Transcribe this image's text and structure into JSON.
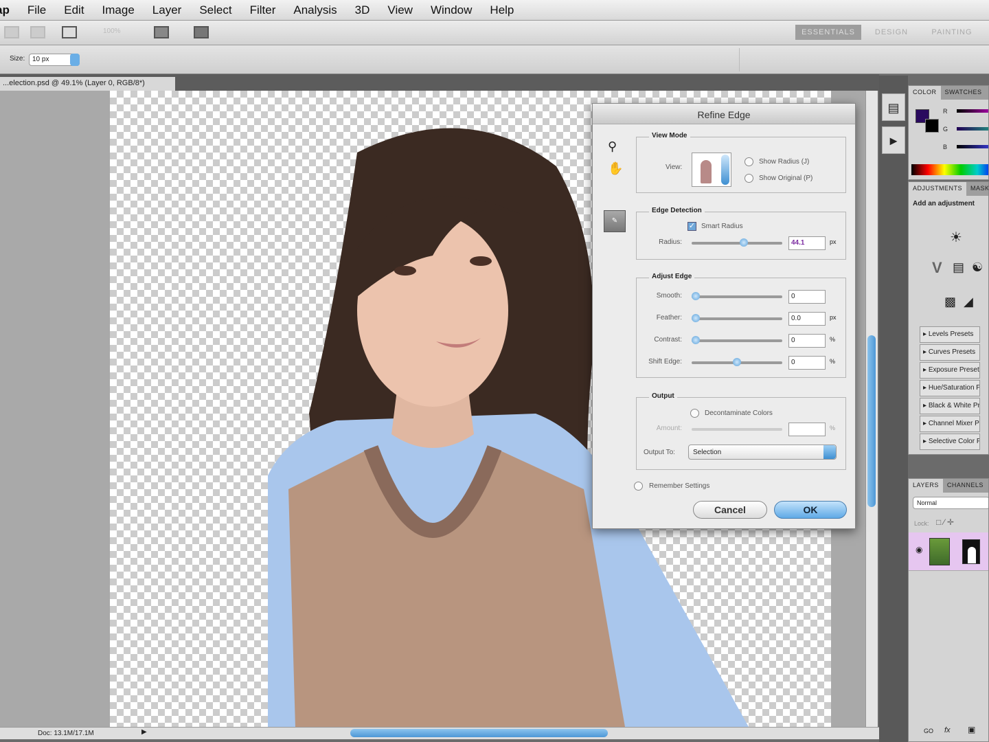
{
  "menu": {
    "items": [
      "ap",
      "File",
      "Edit",
      "Image",
      "Layer",
      "Select",
      "Filter",
      "Analysis",
      "3D",
      "View",
      "Window",
      "Help"
    ]
  },
  "appbar": {
    "zoom": "100%",
    "workspaces": [
      "ESSENTIALS",
      "DESIGN",
      "PAINTING"
    ]
  },
  "options": {
    "size_label": "Size:",
    "size_value": "10 px"
  },
  "document": {
    "tab_title": "...election.psd @ 49.1% (Layer 0, RGB/8*)",
    "status": "Doc: 13.1M/17.1M"
  },
  "dialog": {
    "title": "Refine Edge",
    "view_mode": {
      "label": "View Mode",
      "view_label": "View:",
      "show_radius": "Show Radius (J)",
      "show_original": "Show Original (P)"
    },
    "edge_detection": {
      "label": "Edge Detection",
      "smart_radius": "Smart Radius",
      "radius_label": "Radius:",
      "radius_value": "44.1",
      "radius_unit": "px",
      "radius_fraction": 0.58
    },
    "adjust_edge": {
      "label": "Adjust Edge",
      "rows": [
        {
          "label": "Smooth:",
          "value": "0",
          "unit": "",
          "fraction": 0
        },
        {
          "label": "Feather:",
          "value": "0.0",
          "unit": "px",
          "fraction": 0
        },
        {
          "label": "Contrast:",
          "value": "0",
          "unit": "%",
          "fraction": 0
        },
        {
          "label": "Shift Edge:",
          "value": "0",
          "unit": "%",
          "fraction": 0.5
        }
      ]
    },
    "output": {
      "label": "Output",
      "decontaminate": "Decontaminate Colors",
      "amount_label": "Amount:",
      "amount_unit": "%",
      "output_to_label": "Output To:",
      "output_to_value": "Selection"
    },
    "remember": "Remember Settings",
    "cancel": "Cancel",
    "ok": "OK"
  },
  "panels": {
    "color": {
      "tabs": [
        "COLOR",
        "SWATCHES"
      ],
      "channels": [
        "R",
        "G",
        "B"
      ],
      "foreground": "#2a0a5e",
      "background": "#000000"
    },
    "adjustments": {
      "tabs": [
        "ADJUSTMENTS",
        "MASKS"
      ],
      "subtitle": "Add an adjustment",
      "presets": [
        "Levels Presets",
        "Curves Presets",
        "Exposure Presets",
        "Hue/Saturation Presets",
        "Black & White Presets",
        "Channel Mixer Presets",
        "Selective Color Presets"
      ]
    },
    "layers": {
      "tabs": [
        "LAYERS",
        "CHANNELS"
      ],
      "blend_mode": "Normal",
      "lock_label": "Lock:",
      "footer": [
        "GO",
        "fx"
      ]
    }
  }
}
